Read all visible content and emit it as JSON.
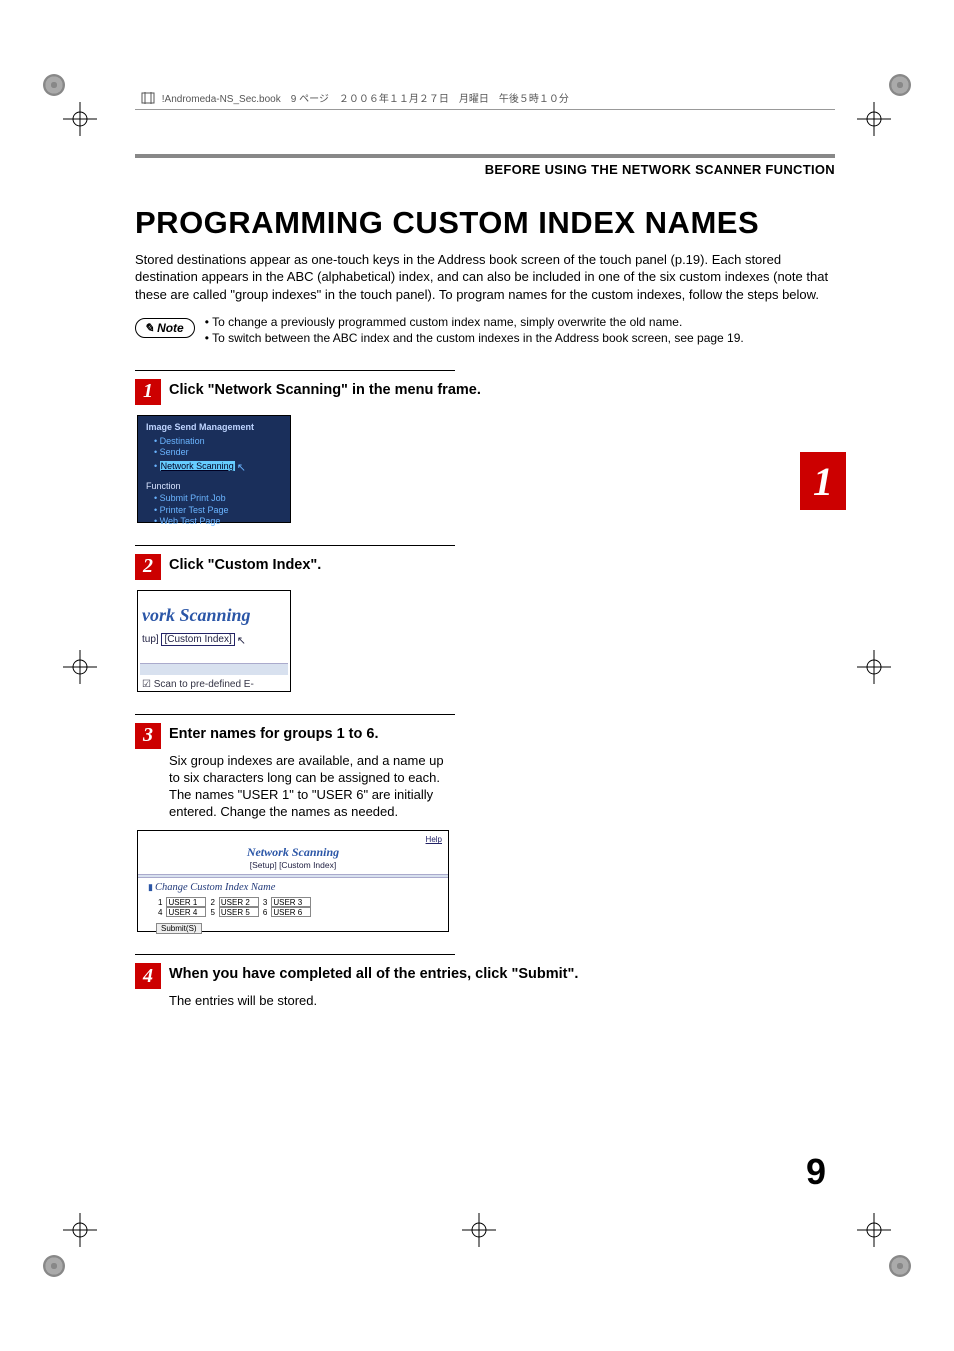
{
  "file_header": "!Andromeda-NS_Sec.book　9 ページ　２００６年１１月２７日　月曜日　午後５時１０分",
  "section_header": "BEFORE USING THE NETWORK SCANNER FUNCTION",
  "title": "PROGRAMMING CUSTOM INDEX NAMES",
  "intro": "Stored destinations appear as one-touch keys in the Address book screen of the touch panel (p.19). Each stored destination appears in the ABC (alphabetical) index, and can also be included in one of the six custom indexes (note that these are called \"group indexes\" in the touch panel). To program names for the custom indexes, follow the steps below.",
  "note_label": "Note",
  "notes": [
    "To change a previously programmed custom index name, simply overwrite the old name.",
    "To switch between the ABC index and the custom indexes in the Address book screen, see page 19."
  ],
  "chapter_tab": "1",
  "page_number": "9",
  "steps": [
    {
      "num": "1",
      "title": "Click \"Network Scanning\" in the menu frame.",
      "body": "",
      "ss1": {
        "hdr": "Image Send Management",
        "items1": [
          "Destination",
          "Sender"
        ],
        "hl": "Network Scanning",
        "sect2": "Function",
        "items2": [
          "Submit Print Job",
          "Printer Test Page",
          "Web Test Page"
        ]
      }
    },
    {
      "num": "2",
      "title": "Click \"Custom Index\".",
      "body": "",
      "ss2": {
        "title": "vork Scanning",
        "crumb_left": "tup]",
        "crumb_box": "[Custom Index]",
        "checkbox": "☑ Scan to pre-defined E-"
      }
    },
    {
      "num": "3",
      "title": "Enter names for groups 1 to 6.",
      "body": "Six group indexes are available, and a name up to six characters long can be assigned to each. The names \"USER 1\" to \"USER 6\" are initially entered. Change the names as needed.",
      "ss3": {
        "help": "Help",
        "title": "Network Scanning",
        "crumb": "[Setup] [Custom Index]",
        "label": "Change Custom Index Name",
        "cells": [
          "1",
          "USER 1",
          "2",
          "USER 2",
          "3",
          "USER 3",
          "4",
          "USER 4",
          "5",
          "USER 5",
          "6",
          "USER 6"
        ],
        "submit": "Submit(S)"
      }
    },
    {
      "num": "4",
      "title": "When you have completed all of the entries, click \"Submit\".",
      "body": "The entries will be stored."
    }
  ]
}
